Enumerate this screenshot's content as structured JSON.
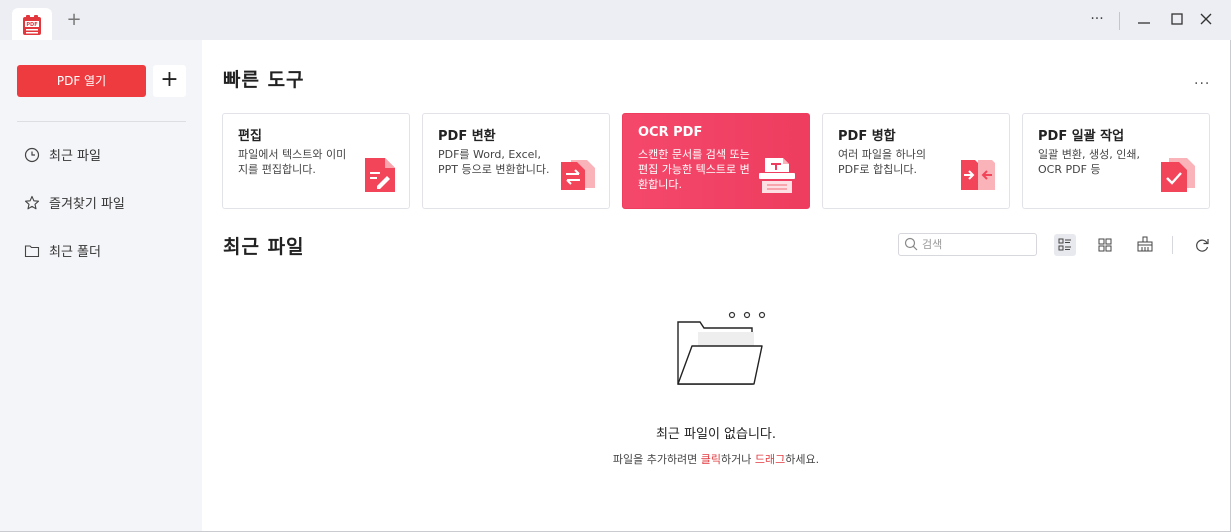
{
  "titlebar": {
    "app_icon": "pdf-app-icon",
    "new_tab_label": "+",
    "controls": {
      "more": "···",
      "minimize": "minimize-icon",
      "maximize": "maximize-icon",
      "close": "close-icon"
    }
  },
  "sidebar": {
    "open_pdf_label": "PDF 열기",
    "add_label": "+",
    "items": [
      {
        "label": "최근 파일",
        "icon": "clock-icon"
      },
      {
        "label": "즐겨찾기 파일",
        "icon": "star-icon"
      },
      {
        "label": "최근 폴더",
        "icon": "folder-icon"
      }
    ]
  },
  "quick_tools": {
    "title": "빠른 도구",
    "more": "···",
    "cards": [
      {
        "title": "편집",
        "desc": "파일에서 텍스트와 이미지를 편집합니다.",
        "icon": "edit-pdf-icon"
      },
      {
        "title": "PDF 변환",
        "desc": "PDF를 Word, Excel, PPT 등으로 변환합니다.",
        "icon": "convert-pdf-icon"
      },
      {
        "title": "OCR PDF",
        "desc": "스캔한 문서를 검색 또는 편집 가능한 텍스트로 변환합니다.",
        "icon": "ocr-scanner-icon"
      },
      {
        "title": "PDF 병합",
        "desc": "여러 파일을 하나의 PDF로 합칩니다.",
        "icon": "merge-pdf-icon"
      },
      {
        "title": "PDF 일괄 작업",
        "desc": "일괄 변환, 생성, 인쇄, OCR PDF 등",
        "icon": "batch-pdf-icon"
      }
    ]
  },
  "recent": {
    "title": "최근 파일",
    "search_placeholder": "검색",
    "empty_title": "최근 파일이 없습니다.",
    "hint_prefix": "파일을 추가하려면 ",
    "hint_click": "클릭",
    "hint_middle": "하거나 ",
    "hint_drag": "드래그",
    "hint_suffix": "하세요."
  },
  "colors": {
    "accent": "#ee3b3f",
    "ocr_card": "#f4486b",
    "sidebar_bg": "#f4f5f8",
    "titlebar_bg": "#eceef3"
  }
}
